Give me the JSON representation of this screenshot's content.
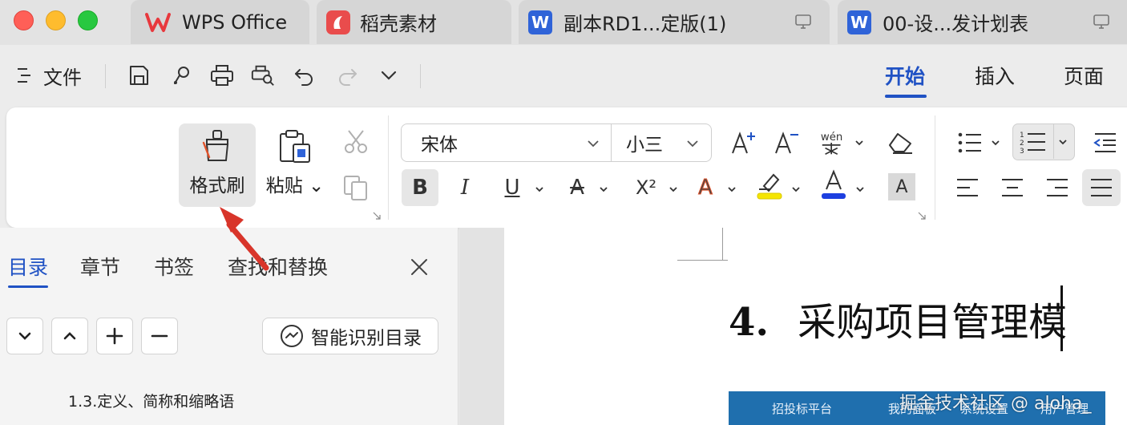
{
  "tabs": [
    {
      "label": "WPS Office",
      "icon": "wps-logo-icon"
    },
    {
      "label": "稻壳素材",
      "icon": "daoke-logo-icon"
    },
    {
      "label": "副本RD1...定版(1)",
      "icon": "word-doc-icon",
      "badge": "W"
    },
    {
      "label": "00-设...发计划表",
      "icon": "word-doc-icon",
      "badge": "W"
    }
  ],
  "menu": {
    "file_label": "文件"
  },
  "ribbon_tabs": [
    "开始",
    "插入",
    "页面"
  ],
  "ribbon": {
    "format_brush_label": "格式刷",
    "paste_label": "粘贴",
    "font_name": "宋体",
    "font_size": "小三",
    "bold_label": "B",
    "italic_label": "I",
    "underline_label": "U",
    "strike_label": "A",
    "superscript_label": "X²",
    "highlight_label": "A",
    "font_color_label": "A",
    "char_shade_label": "A"
  },
  "sidebar": {
    "tabs": [
      "目录",
      "章节",
      "书签",
      "查找和替换"
    ],
    "smart_toc_label": "智能识别目录",
    "toc_items": [
      "1.3.定义、简称和缩略语"
    ]
  },
  "document": {
    "heading_number": "4.",
    "heading_text": "采购项目管理模",
    "nav_bar_items": [
      "招投标平台",
      "我的面板",
      "系统设置",
      "用户管理"
    ]
  },
  "watermark": "掘金技术社区 @ aloha_",
  "colors": {
    "accent": "#2052c4",
    "highlight_yellow": "#f5e500",
    "font_color_blue": "#1d3fe0",
    "annotation_arrow": "#d8352a",
    "nav_bar": "#1f6fae"
  }
}
